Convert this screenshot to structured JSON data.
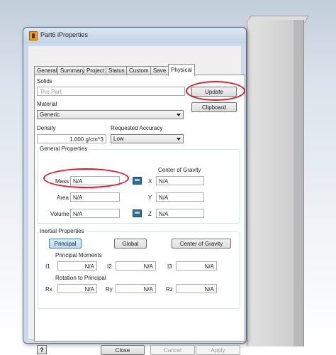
{
  "window": {
    "title": "Part6 iProperties"
  },
  "tabs": [
    {
      "label": "General"
    },
    {
      "label": "Summary"
    },
    {
      "label": "Project"
    },
    {
      "label": "Status"
    },
    {
      "label": "Custom"
    },
    {
      "label": "Save"
    },
    {
      "label": "Physical"
    }
  ],
  "active_tab": "Physical",
  "solids": {
    "label": "Solids",
    "value": "The Part"
  },
  "buttons": {
    "update": "Update",
    "clipboard": "Clipboard"
  },
  "material": {
    "label": "Material",
    "value": "Generic"
  },
  "density": {
    "label": "Density",
    "value": "1.000 g/cm^3"
  },
  "accuracy": {
    "label": "Requested Accuracy",
    "value": "Low"
  },
  "general_properties": {
    "title": "General Properties",
    "mass": {
      "label": "Mass",
      "value": "N/A"
    },
    "area": {
      "label": "Area",
      "value": "N/A"
    },
    "volume": {
      "label": "Volume",
      "value": "N/A"
    },
    "cog_title": "Center of Gravity",
    "x": {
      "label": "X",
      "value": "N/A"
    },
    "y": {
      "label": "Y",
      "value": "N/A"
    },
    "z": {
      "label": "Z",
      "value": "N/A"
    }
  },
  "inertial_properties": {
    "title": "Inertial Properties",
    "buttons": {
      "principal": "Principal",
      "global": "Global",
      "cog": "Center of Gravity"
    },
    "principal_moments": "Principal Moments",
    "i1": {
      "label": "I1",
      "value": "N/A"
    },
    "i2": {
      "label": "I2",
      "value": "N/A"
    },
    "i3": {
      "label": "I3",
      "value": "N/A"
    },
    "rotation": "Rotation to Principal",
    "rx": {
      "label": "Rx",
      "value": "N/A"
    },
    "ry": {
      "label": "Ry",
      "value": "N/A"
    },
    "rz": {
      "label": "Rz",
      "value": "N/A"
    }
  },
  "footer": {
    "help": "?",
    "close": "Close",
    "cancel": "Cancel",
    "apply": "Apply"
  },
  "colors": {
    "annotation": "#e0182a",
    "pressed_button": "#b8ddf6",
    "dialog_frame": "#ccd9e8"
  },
  "icons": [
    "app-icon",
    "calculator-icon",
    "help-icon"
  ]
}
